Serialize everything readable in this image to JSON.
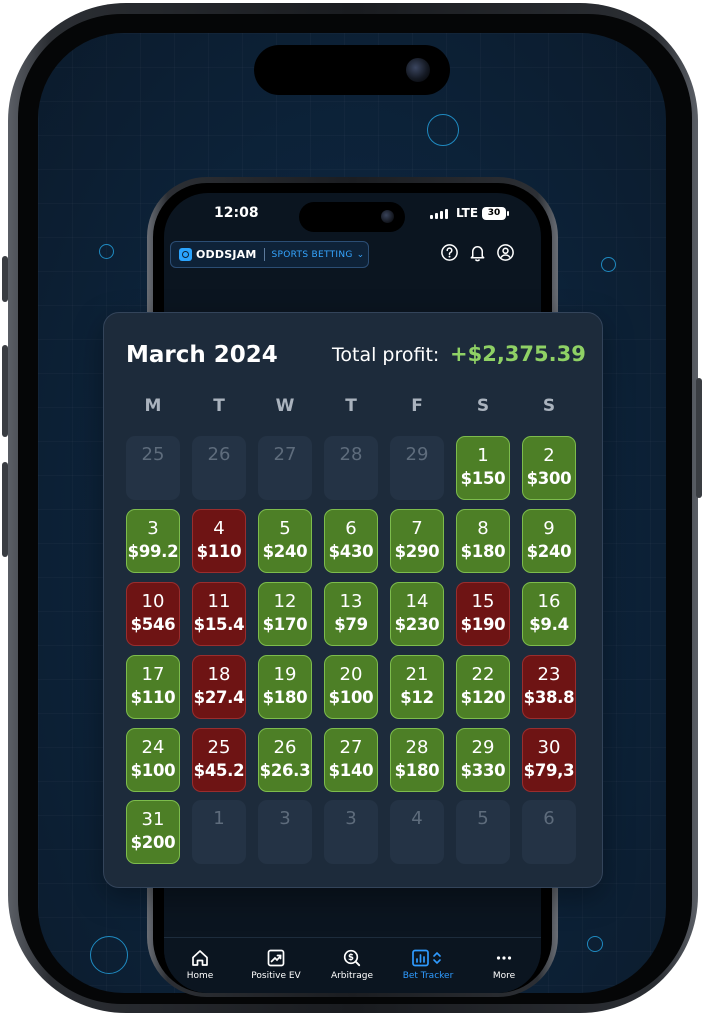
{
  "phone": {
    "status_time": "12:08",
    "network": "LTE",
    "battery": "30"
  },
  "app_header": {
    "brand": "ODDSJAM",
    "section": "SPORTS BETTING"
  },
  "calendar": {
    "month_title": "March 2024",
    "total_profit_label": "Total profit:",
    "total_profit_value": "+$2,375.39",
    "weekdays": [
      "M",
      "T",
      "W",
      "T",
      "F",
      "S",
      "S"
    ],
    "colors": {
      "positive": "#4d7f26",
      "negative": "#6e1414",
      "empty": "#243345",
      "profit_text": "#8fd165"
    },
    "weeks": [
      [
        {
          "day": "25",
          "amount": "",
          "status": "empty"
        },
        {
          "day": "26",
          "amount": "",
          "status": "empty"
        },
        {
          "day": "27",
          "amount": "",
          "status": "empty"
        },
        {
          "day": "28",
          "amount": "",
          "status": "empty"
        },
        {
          "day": "29",
          "amount": "",
          "status": "empty"
        },
        {
          "day": "1",
          "amount": "$150",
          "status": "positive"
        },
        {
          "day": "2",
          "amount": "$300",
          "status": "positive"
        }
      ],
      [
        {
          "day": "3",
          "amount": "$99.2",
          "status": "positive"
        },
        {
          "day": "4",
          "amount": "$110",
          "status": "negative"
        },
        {
          "day": "5",
          "amount": "$240",
          "status": "positive"
        },
        {
          "day": "6",
          "amount": "$430",
          "status": "positive"
        },
        {
          "day": "7",
          "amount": "$290",
          "status": "positive"
        },
        {
          "day": "8",
          "amount": "$180",
          "status": "positive"
        },
        {
          "day": "9",
          "amount": "$240",
          "status": "positive"
        }
      ],
      [
        {
          "day": "10",
          "amount": "$546",
          "status": "negative"
        },
        {
          "day": "11",
          "amount": "$15.4",
          "status": "negative"
        },
        {
          "day": "12",
          "amount": "$170",
          "status": "positive"
        },
        {
          "day": "13",
          "amount": "$79",
          "status": "positive"
        },
        {
          "day": "14",
          "amount": "$230",
          "status": "positive"
        },
        {
          "day": "15",
          "amount": "$190",
          "status": "negative"
        },
        {
          "day": "16",
          "amount": "$9.4",
          "status": "positive"
        }
      ],
      [
        {
          "day": "17",
          "amount": "$110",
          "status": "positive"
        },
        {
          "day": "18",
          "amount": "$27.4",
          "status": "negative"
        },
        {
          "day": "19",
          "amount": "$180",
          "status": "positive"
        },
        {
          "day": "20",
          "amount": "$100",
          "status": "positive"
        },
        {
          "day": "21",
          "amount": "$12",
          "status": "positive"
        },
        {
          "day": "22",
          "amount": "$120",
          "status": "positive"
        },
        {
          "day": "23",
          "amount": "$38.8",
          "status": "negative"
        }
      ],
      [
        {
          "day": "24",
          "amount": "$100",
          "status": "positive"
        },
        {
          "day": "25",
          "amount": "$45.2",
          "status": "negative"
        },
        {
          "day": "26",
          "amount": "$26.3",
          "status": "positive"
        },
        {
          "day": "27",
          "amount": "$140",
          "status": "positive"
        },
        {
          "day": "28",
          "amount": "$180",
          "status": "positive"
        },
        {
          "day": "29",
          "amount": "$330",
          "status": "positive"
        },
        {
          "day": "30",
          "amount": "$79,3",
          "status": "negative"
        }
      ],
      [
        {
          "day": "31",
          "amount": "$200",
          "status": "positive"
        },
        {
          "day": "1",
          "amount": "",
          "status": "empty"
        },
        {
          "day": "3",
          "amount": "",
          "status": "empty"
        },
        {
          "day": "3",
          "amount": "",
          "status": "empty"
        },
        {
          "day": "4",
          "amount": "",
          "status": "empty"
        },
        {
          "day": "5",
          "amount": "",
          "status": "empty"
        },
        {
          "day": "6",
          "amount": "",
          "status": "empty"
        }
      ]
    ]
  },
  "tabbar": {
    "tabs": [
      {
        "label": "Home",
        "icon": "home-icon",
        "active": false
      },
      {
        "label": "Positive EV",
        "icon": "chart-trend-icon",
        "active": false
      },
      {
        "label": "Arbitrage",
        "icon": "dollar-search-icon",
        "active": false
      },
      {
        "label": "Bet Tracker",
        "icon": "bar-chart-icon",
        "active": true
      },
      {
        "label": "More",
        "icon": "more-icon",
        "active": false
      }
    ]
  }
}
